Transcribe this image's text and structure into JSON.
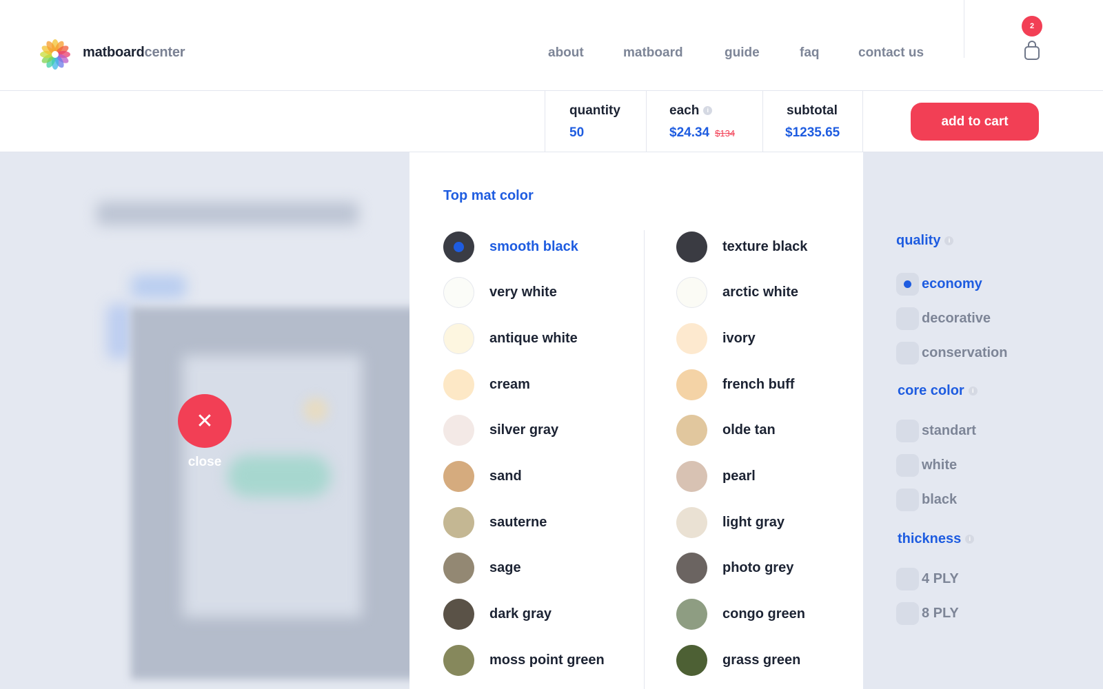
{
  "brand": {
    "name_bold": "matboard",
    "name_light": "center"
  },
  "nav": {
    "items": [
      "about",
      "matboard",
      "guide",
      "faq",
      "contact us"
    ]
  },
  "cart": {
    "count": "2"
  },
  "summary": {
    "quantity_label": "quantity",
    "quantity_value": "50",
    "each_label": "each",
    "each_value": "$24.34",
    "each_old": "$134",
    "subtotal_label": "subtotal",
    "subtotal_value": "$1235.65",
    "add_to_cart": "add to cart",
    "info_glyph": "i"
  },
  "preview": {
    "close_label": "close",
    "close_glyph": "✕"
  },
  "panel": {
    "title": "Top mat color",
    "selected": "smooth black",
    "left_colors": [
      {
        "name": "smooth black",
        "color": "#3a3c44"
      },
      {
        "name": "very white",
        "color": "#fbfcf8"
      },
      {
        "name": "antique white",
        "color": "#fdf6e0"
      },
      {
        "name": "cream",
        "color": "#fde8c6"
      },
      {
        "name": "silver gray",
        "color": "#f3e9e6"
      },
      {
        "name": "sand",
        "color": "#d5ab7e"
      },
      {
        "name": "sauterne",
        "color": "#c4b793"
      },
      {
        "name": "sage",
        "color": "#938873"
      },
      {
        "name": "dark gray",
        "color": "#5a5247"
      },
      {
        "name": "moss point green",
        "color": "#86885c"
      }
    ],
    "right_colors": [
      {
        "name": "texture black",
        "color": "#3a3b42"
      },
      {
        "name": "arctic white",
        "color": "#fbfbf5"
      },
      {
        "name": "ivory",
        "color": "#fde9cf"
      },
      {
        "name": "french buff",
        "color": "#f4d3a6"
      },
      {
        "name": "olde tan",
        "color": "#e1c79e"
      },
      {
        "name": "pearl",
        "color": "#d8c2b3"
      },
      {
        "name": "light gray",
        "color": "#eae1d3"
      },
      {
        "name": "photo grey",
        "color": "#6b6461"
      },
      {
        "name": "congo green",
        "color": "#8e9d82"
      },
      {
        "name": "grass green",
        "color": "#4d6034"
      }
    ]
  },
  "options": {
    "quality": {
      "title": "quality",
      "items": [
        "economy",
        "decorative",
        "conservation"
      ],
      "selected": "economy"
    },
    "core_color": {
      "title": "core color",
      "items": [
        "standart",
        "white",
        "black"
      ]
    },
    "thickness": {
      "title": "thickness",
      "items": [
        "4 PLY",
        "8 PLY"
      ]
    }
  }
}
